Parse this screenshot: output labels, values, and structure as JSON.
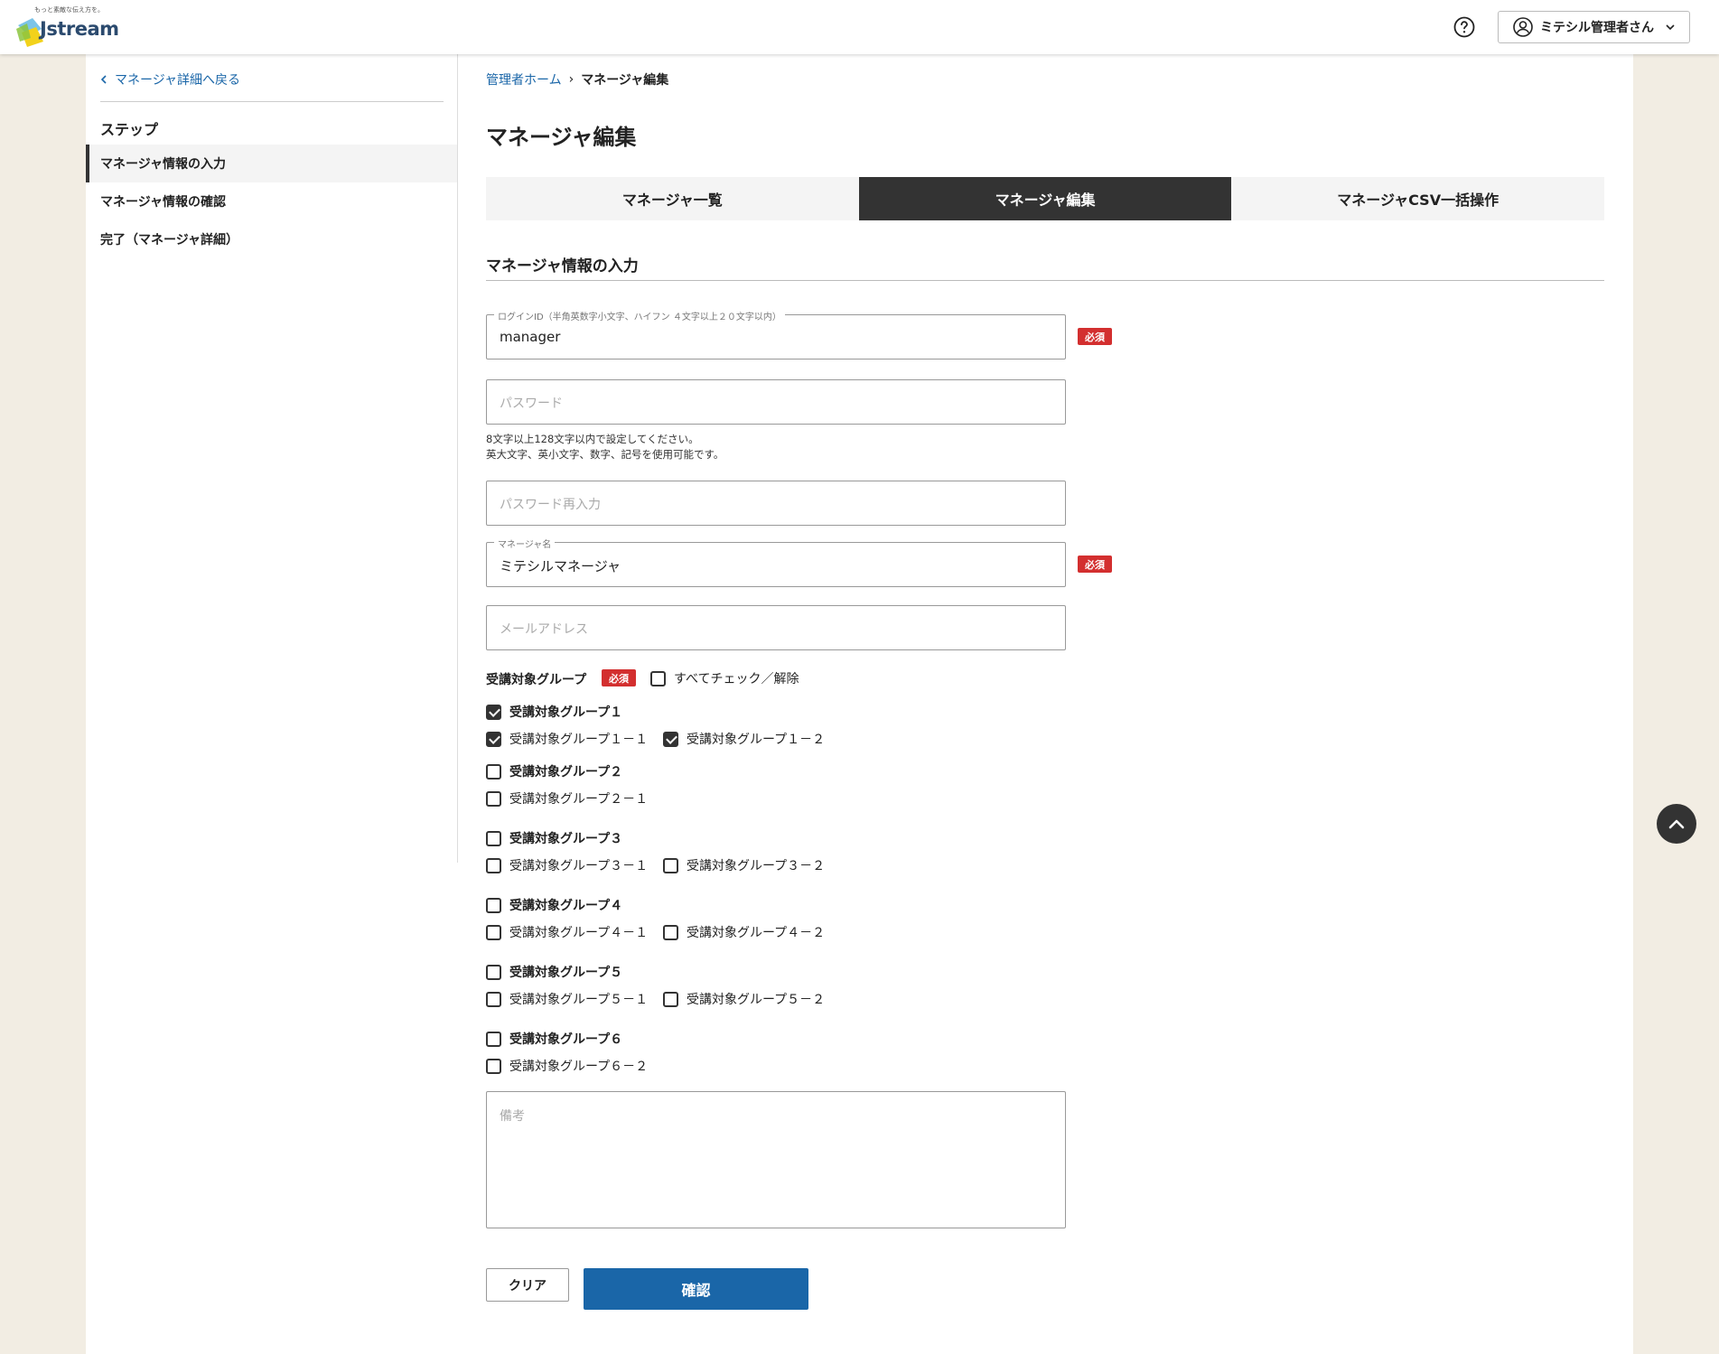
{
  "header": {
    "logo_tagline": "もっと素敵な伝え方を。",
    "logo_text": "Jstream",
    "user_label": "ミテシル管理者さん"
  },
  "sidebar": {
    "back_link": "マネージャ詳細へ戻る",
    "steps_title": "ステップ",
    "steps": [
      {
        "label": "マネージャ情報の入力",
        "active": true
      },
      {
        "label": "マネージャ情報の確認",
        "active": false
      },
      {
        "label": "完了（マネージャ詳細）",
        "active": false
      }
    ]
  },
  "breadcrumb": {
    "home": "管理者ホーム",
    "separator": "›",
    "current": "マネージャ編集"
  },
  "page_title": "マネージャ編集",
  "tabs": [
    {
      "label": "マネージャ一覧",
      "active": false
    },
    {
      "label": "マネージャ編集",
      "active": true
    },
    {
      "label": "マネージャCSV一括操作",
      "active": false
    }
  ],
  "section_title": "マネージャ情報の入力",
  "form": {
    "login_id": {
      "label": "ログインID（半角英数字小文字、ハイフン ４文字以上２０文字以内）",
      "value": "manager"
    },
    "password": {
      "placeholder": "パスワード"
    },
    "password_hint_1": "8文字以上128文字以内で設定してください。",
    "password_hint_2": "英大文字、英小文字、数字、記号を使用可能です。",
    "password_confirm": {
      "placeholder": "パスワード再入力"
    },
    "manager_name": {
      "label": "マネージャ名",
      "value": "ミテシルマネージャ"
    },
    "email": {
      "placeholder": "メールアドレス"
    },
    "required_badge": "必須",
    "group_label": "受講対象グループ",
    "check_all_label": "すべてチェック／解除",
    "groups": [
      {
        "label": "受講対象グループ１",
        "checked": true,
        "children": [
          {
            "label": "受講対象グループ１－１",
            "checked": true
          },
          {
            "label": "受講対象グループ１－２",
            "checked": true
          }
        ]
      },
      {
        "label": "受講対象グループ２",
        "checked": false,
        "children": [
          {
            "label": "受講対象グループ２－１",
            "checked": false
          }
        ]
      },
      {
        "label": "受講対象グループ３",
        "checked": false,
        "children": [
          {
            "label": "受講対象グループ３－１",
            "checked": false
          },
          {
            "label": "受講対象グループ３－２",
            "checked": false
          }
        ]
      },
      {
        "label": "受講対象グループ４",
        "checked": false,
        "children": [
          {
            "label": "受講対象グループ４－１",
            "checked": false
          },
          {
            "label": "受講対象グループ４－２",
            "checked": false
          }
        ]
      },
      {
        "label": "受講対象グループ５",
        "checked": false,
        "children": [
          {
            "label": "受講対象グループ５－１",
            "checked": false
          },
          {
            "label": "受講対象グループ５－２",
            "checked": false
          }
        ]
      },
      {
        "label": "受講対象グループ６",
        "checked": false,
        "children": [
          {
            "label": "受講対象グループ６－２",
            "checked": false
          }
        ]
      }
    ],
    "notes": {
      "placeholder": "備考"
    }
  },
  "buttons": {
    "clear": "クリア",
    "confirm": "確認"
  },
  "colors": {
    "accent": "#1a66a8",
    "required": "#d32f2f",
    "dark": "#333333",
    "background": "#f2ede3"
  }
}
